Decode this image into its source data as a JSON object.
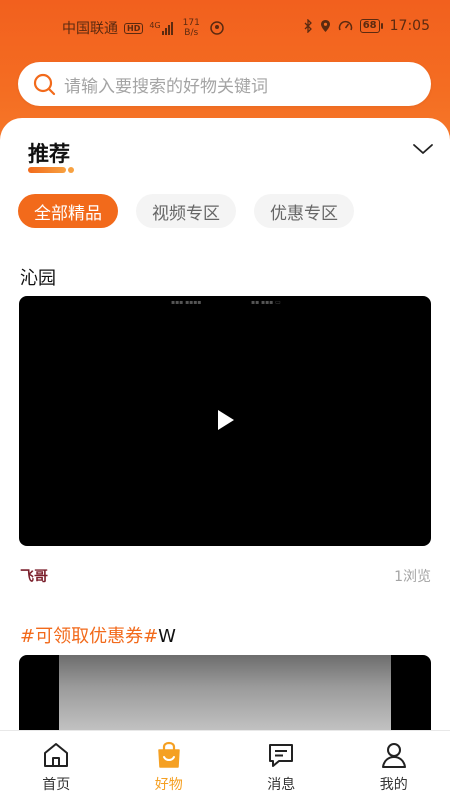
{
  "status_bar": {
    "carrier": "中国联通",
    "hd_badge": "HD",
    "network": "4G",
    "speed_value": "171",
    "speed_unit": "B/s",
    "battery": "68",
    "time": "17:05"
  },
  "search": {
    "placeholder": "请输入要搜索的好物关键词"
  },
  "section": {
    "title": "推荐"
  },
  "tabs": [
    {
      "label": "全部精品",
      "active": true
    },
    {
      "label": "视频专区",
      "active": false
    },
    {
      "label": "优惠专区",
      "active": false
    }
  ],
  "posts": [
    {
      "title": "沁园",
      "author": "飞哥",
      "views": "1浏览"
    },
    {
      "title_hashtag": "#可领取优惠券#",
      "title_suffix": "W"
    }
  ],
  "nav": [
    {
      "label": "首页",
      "icon": "home-icon",
      "active": false
    },
    {
      "label": "好物",
      "icon": "shopping-bag-icon",
      "active": true
    },
    {
      "label": "消息",
      "icon": "message-icon",
      "active": false
    },
    {
      "label": "我的",
      "icon": "user-icon",
      "active": false
    }
  ],
  "colors": {
    "brand_orange": "#f26a1b",
    "nav_active": "#f5a023",
    "author": "#7a1f2b"
  }
}
